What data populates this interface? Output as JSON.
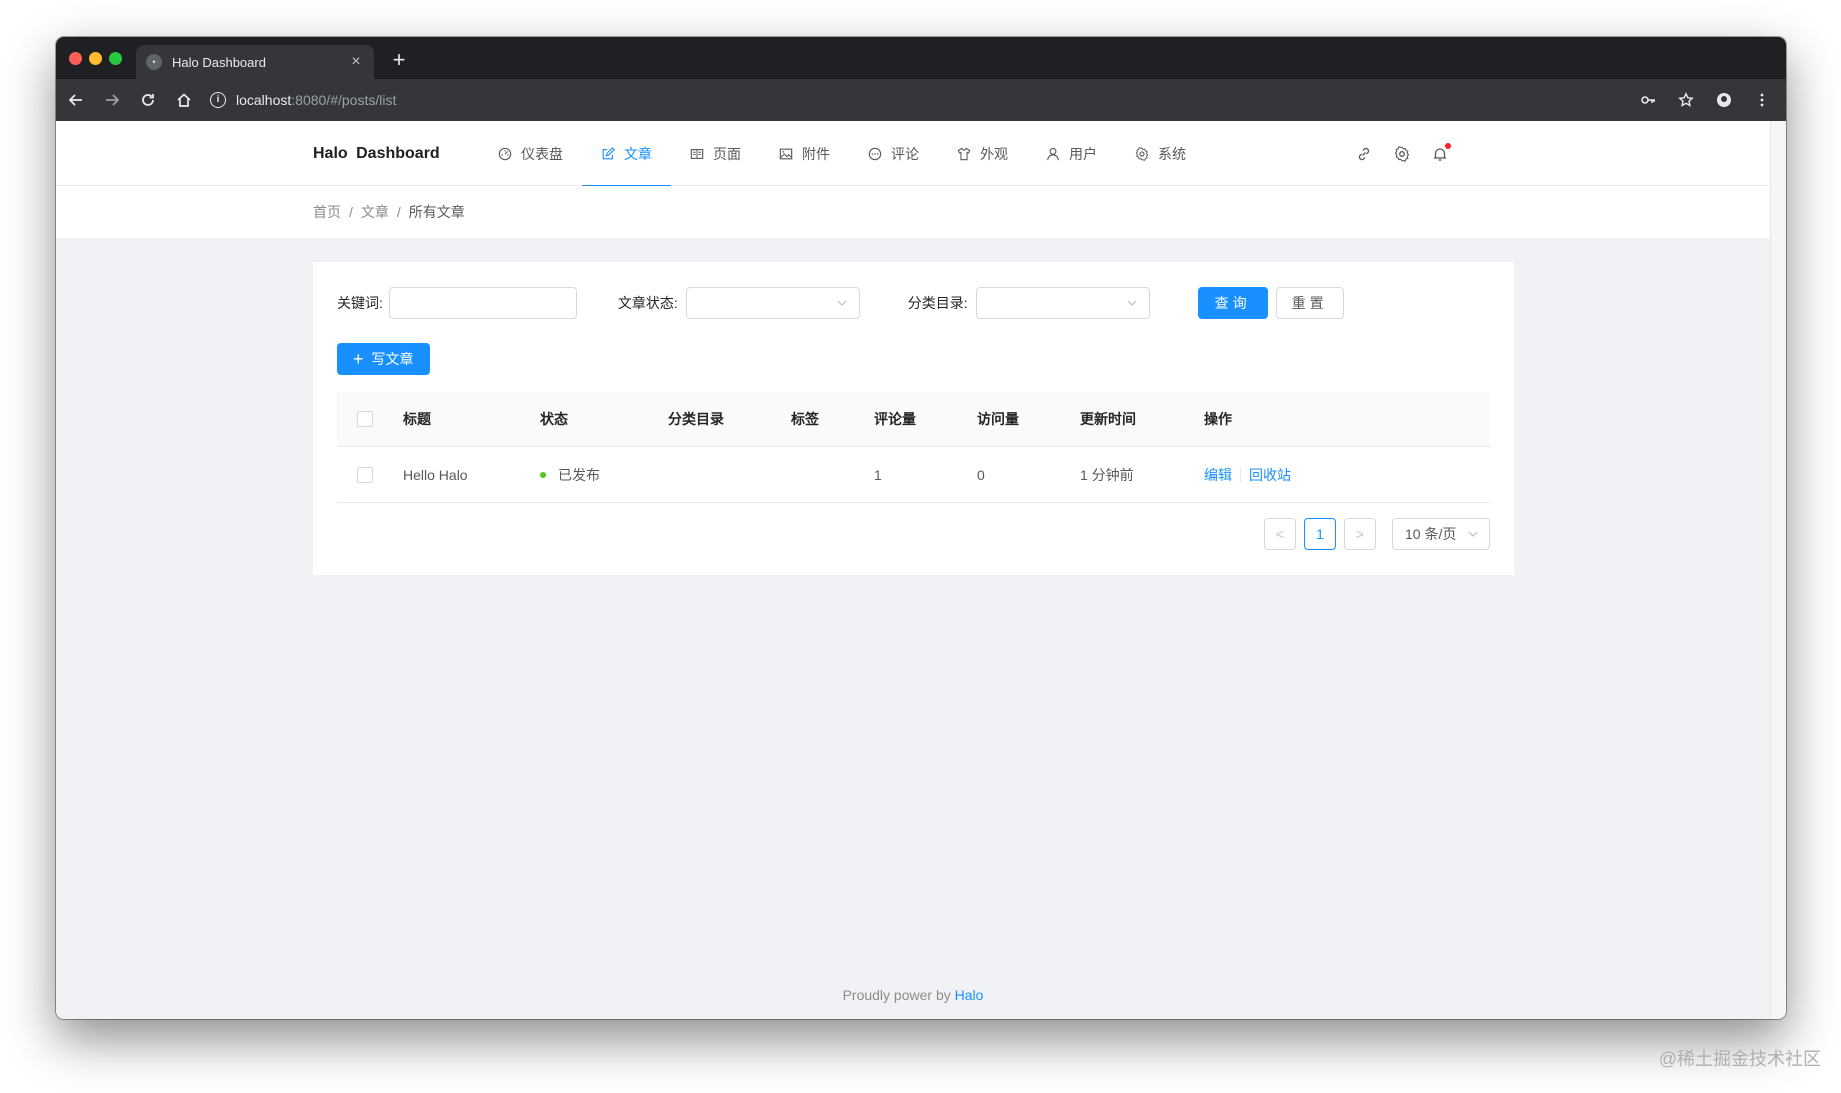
{
  "browser": {
    "tab_title": "Halo Dashboard",
    "url_host": "localhost",
    "url_rest": ":8080/#/posts/list"
  },
  "header": {
    "logo": "Halo  Dashboard",
    "menu": [
      {
        "label": "仪表盘",
        "icon": "dashboard-icon"
      },
      {
        "label": "文章",
        "icon": "form-icon"
      },
      {
        "label": "页面",
        "icon": "read-icon"
      },
      {
        "label": "附件",
        "icon": "picture-icon"
      },
      {
        "label": "评论",
        "icon": "message-icon"
      },
      {
        "label": "外观",
        "icon": "skin-icon"
      },
      {
        "label": "用户",
        "icon": "user-icon"
      },
      {
        "label": "系统",
        "icon": "setting-icon"
      }
    ]
  },
  "breadcrumb": {
    "items": [
      "首页",
      "文章",
      "所有文章"
    ],
    "separator": "/"
  },
  "filters": {
    "keyword_label": "关键词:",
    "status_label": "文章状态:",
    "category_label": "分类目录:",
    "query_button": "查询",
    "reset_button": "重置"
  },
  "write_button": "写文章",
  "table": {
    "columns": [
      "标题",
      "状态",
      "分类目录",
      "标签",
      "评论量",
      "访问量",
      "更新时间",
      "操作"
    ],
    "rows": [
      {
        "title": "Hello Halo",
        "status": "已发布",
        "category": "",
        "tags": "",
        "comments": "1",
        "visits": "0",
        "updated": "1 分钟前",
        "edit": "编辑",
        "recycle": "回收站"
      }
    ]
  },
  "pagination": {
    "prev": "<",
    "current_page": "1",
    "next": ">",
    "page_size": "10 条/页"
  },
  "footer": {
    "text": "Proudly power by ",
    "link": "Halo"
  },
  "watermark": "@稀土掘金技术社区",
  "colors": {
    "primary": "#1890ff",
    "status_published": "#52c41a",
    "notification_dot": "#f5222d"
  }
}
